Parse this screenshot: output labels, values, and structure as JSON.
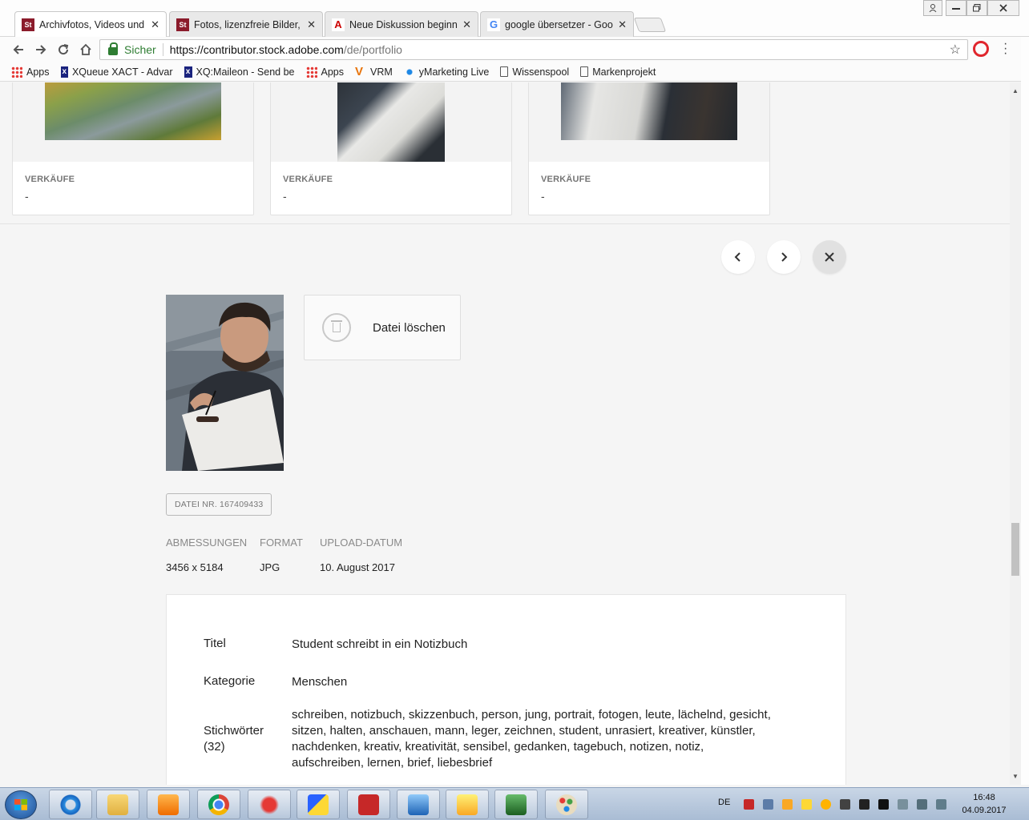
{
  "browser": {
    "tabs": [
      {
        "label": "Archivfotos, Videos und V",
        "favicon": "St",
        "favicon_color": "#8b1b2b",
        "active": true
      },
      {
        "label": "Fotos, lizenzfreie Bilder, G",
        "favicon": "St",
        "favicon_color": "#8b1b2b",
        "active": false
      },
      {
        "label": "Neue Diskussion beginne",
        "favicon": "A",
        "favicon_color": "#cc0000",
        "active": false
      },
      {
        "label": "google übersetzer - Goo",
        "favicon": "G",
        "favicon_color": "#4285f4",
        "active": false
      }
    ],
    "close_glyph": "✕",
    "address": {
      "secure_label": "Sicher",
      "url_host": "https://contributor.stock.adobe.com",
      "url_path": "/de/portfolio"
    },
    "bookmarks": [
      {
        "label": "Apps",
        "icon": "apps-grid-icon"
      },
      {
        "label": "XQueue XACT - Advar",
        "icon": "xqueue-icon"
      },
      {
        "label": "XQ:Maileon - Send be",
        "icon": "xqueue-icon"
      },
      {
        "label": "Apps",
        "icon": "apps-grid-icon"
      },
      {
        "label": "VRM",
        "icon": "vrm-icon"
      },
      {
        "label": "yMarketing Live",
        "icon": "ymarketing-icon"
      },
      {
        "label": "Wissenspool",
        "icon": "document-icon"
      },
      {
        "label": "Markenprojekt",
        "icon": "document-icon"
      }
    ]
  },
  "portfolio": {
    "cards": [
      {
        "sales_label": "VERKÄUFE",
        "sales_value": "-"
      },
      {
        "sales_label": "VERKÄUFE",
        "sales_value": "-"
      },
      {
        "sales_label": "VERKÄUFE",
        "sales_value": "-"
      }
    ],
    "nav": {
      "prev": "‹",
      "next": "›",
      "close": "✕"
    }
  },
  "detail": {
    "delete_label": "Datei löschen",
    "file_number": "DATEI NR. 167409433",
    "meta": [
      {
        "label": "ABMESSUNGEN",
        "value": "3456 x 5184"
      },
      {
        "label": "FORMAT",
        "value": "JPG"
      },
      {
        "label": "UPLOAD-DATUM",
        "value": "10. August 2017"
      }
    ],
    "info": {
      "title_label": "Titel",
      "title_value": "Student schreibt in ein Notizbuch",
      "category_label": "Kategorie",
      "category_value": "Menschen",
      "keywords_label": "Stichwörter (32)",
      "keywords_value": "schreiben, notizbuch, skizzenbuch, person, jung, portrait, fotogen, leute, lächelnd, gesicht, sitzen, halten, anschauen, mann, leger, zeichnen, student, unrasiert, kreativer, künstler, nachdenken, kreativ, kreativität, sensibel, gedanken, tagebuch, notizen, notiz, aufschreiben, lernen, brief, liebesbrief"
    }
  },
  "taskbar": {
    "language": "DE",
    "time": "16:48",
    "date": "04.09.2017"
  }
}
